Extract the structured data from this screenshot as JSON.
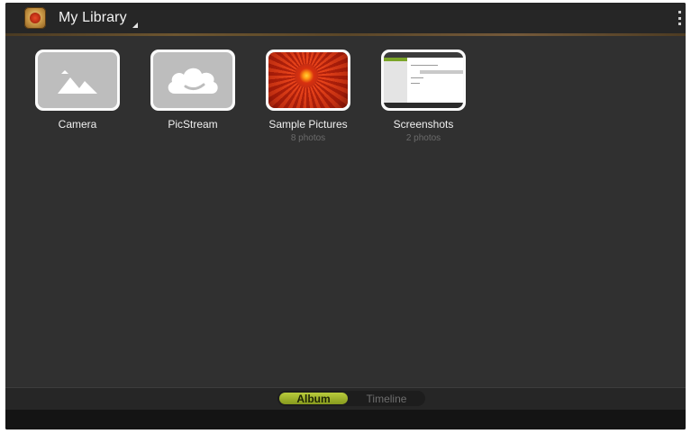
{
  "header": {
    "title": "My Library",
    "app_icon": "gallery-app-icon",
    "menu_icon": "overflow-menu-icon"
  },
  "albums": [
    {
      "name": "Camera",
      "count": "",
      "icon": "mountain-icon"
    },
    {
      "name": "PicStream",
      "count": "",
      "icon": "cloud-icon"
    },
    {
      "name": "Sample Pictures",
      "count": "8 photos",
      "icon": "flower-photo"
    },
    {
      "name": "Screenshots",
      "count": "2 photos",
      "icon": "screenshot-photo"
    }
  ],
  "tabs": {
    "album": "Album",
    "timeline": "Timeline",
    "selected": "Album"
  },
  "colors": {
    "accent": "#9fb52c",
    "background": "#303030",
    "actionbar": "#262626"
  }
}
